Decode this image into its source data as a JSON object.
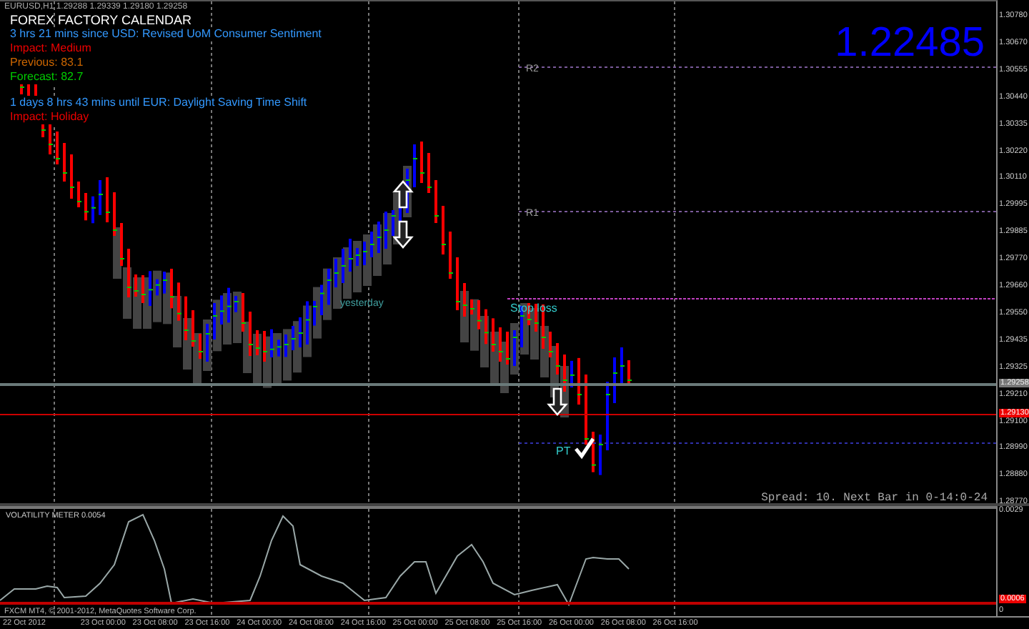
{
  "chart": {
    "symbol_info": "EURUSD,H1  1.29288 1.29339 1.29180 1.29258",
    "calendar": {
      "title": "FOREX FACTORY CALENDAR",
      "events": [
        {
          "lines": [
            {
              "kind": "countdown",
              "text": "3 hrs 21 mins since USD: Revised UoM Consumer Sentiment"
            },
            {
              "kind": "impact",
              "text": "Impact: Medium"
            },
            {
              "kind": "previous",
              "text": "Previous: 83.1"
            },
            {
              "kind": "forecast",
              "text": "Forecast: 82.7"
            }
          ]
        },
        {
          "lines": [
            {
              "kind": "countdown",
              "text": "1 days 8 hrs 43 mins until EUR: Daylight Saving Time Shift"
            },
            {
              "kind": "impact",
              "text": "Impact: Holiday"
            }
          ]
        }
      ]
    },
    "price_display": "1.22485",
    "levels": [
      {
        "label": "R2"
      },
      {
        "label": "R1"
      }
    ],
    "annotations": [
      {
        "kind": "day",
        "text": "yesterday"
      },
      {
        "kind": "stop",
        "text": "Stop loss"
      },
      {
        "kind": "target",
        "text": "PT"
      }
    ],
    "status_text": "Spread: 10. Next Bar in 0-14:0-24",
    "price_axis": [
      {
        "kind": "tick",
        "text": "1.30780"
      },
      {
        "kind": "tick",
        "text": "1.30670"
      },
      {
        "kind": "tick",
        "text": "1.30555"
      },
      {
        "kind": "tick",
        "text": "1.30440"
      },
      {
        "kind": "tick",
        "text": "1.30335"
      },
      {
        "kind": "tick",
        "text": "1.30220"
      },
      {
        "kind": "tick",
        "text": "1.30110"
      },
      {
        "kind": "tick",
        "text": "1.29995"
      },
      {
        "kind": "tick",
        "text": "1.29885"
      },
      {
        "kind": "tick",
        "text": "1.29770"
      },
      {
        "kind": "tick",
        "text": "1.29660"
      },
      {
        "kind": "tick",
        "text": "1.29550"
      },
      {
        "kind": "tick",
        "text": "1.29435"
      },
      {
        "kind": "tick",
        "text": "1.29325"
      },
      {
        "kind": "bid",
        "text": "1.29258"
      },
      {
        "kind": "tick",
        "text": "1.29210"
      },
      {
        "kind": "alert",
        "text": "1.29130"
      },
      {
        "kind": "tick",
        "text": "1.29100"
      },
      {
        "kind": "tick",
        "text": "1.28990"
      },
      {
        "kind": "tick",
        "text": "1.28880"
      },
      {
        "kind": "tick",
        "text": "1.28770"
      }
    ]
  },
  "indicator": {
    "title": "VOLATILITY METER  0.0054",
    "copyright": "FXCM MT4, © 2001-2012, MetaQuotes Software Corp.",
    "axis": [
      {
        "kind": "tick",
        "text": "0.0029"
      },
      {
        "kind": "alert",
        "text": "0.0006"
      },
      {
        "kind": "zero",
        "text": "0"
      }
    ]
  },
  "time_axis": [
    "22 Oct 2012",
    "23 Oct 00:00",
    "23 Oct 08:00",
    "23 Oct 16:00",
    "24 Oct 00:00",
    "24 Oct 08:00",
    "24 Oct 16:00",
    "25 Oct 00:00",
    "25 Oct 08:00",
    "25 Oct 16:00",
    "26 Oct 00:00",
    "26 Oct 08:00",
    "26 Oct 16:00"
  ]
}
